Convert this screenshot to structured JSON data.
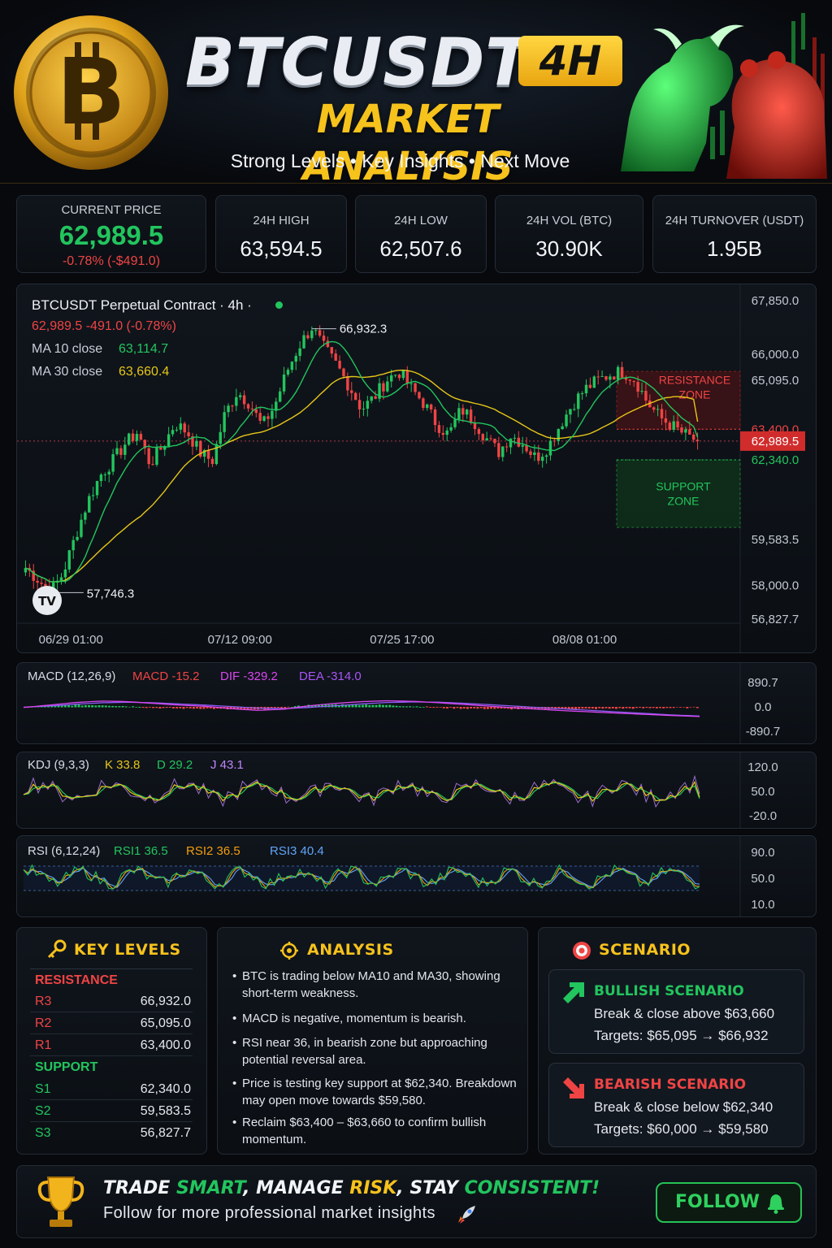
{
  "header": {
    "title": "BTCUSDT",
    "timeframe_badge": "4H",
    "subtitle": "MARKET ANALYSIS",
    "tagline": "Strong Levels  •  Key Insights  •  Next Move",
    "coin_symbol": "B"
  },
  "stats": [
    {
      "label": "CURRENT PRICE",
      "value": "62,989.5",
      "change": "-0.78% (-$491.0)"
    },
    {
      "label": "24H HIGH",
      "value": "63,594.5"
    },
    {
      "label": "24H LOW",
      "value": "62,507.6"
    },
    {
      "label": "24H VOL (BTC)",
      "value": "30.90K"
    },
    {
      "label": "24H TURNOVER (USDT)",
      "value": "1.95B"
    }
  ],
  "price_chart": {
    "symbol_line": "BTCUSDT Perpetual Contract · 4h ·",
    "price_line": "62,989.5  -491.0 (-0.78%)",
    "ma10_label": "MA 10 close",
    "ma10_value": "63,114.7",
    "ma30_label": "MA 30 close",
    "ma30_value": "63,660.4",
    "high_marker": "66,932.3",
    "low_marker": "57,746.3",
    "logo": "TV",
    "resistance_zone": "RESISTANCE ZONE",
    "support_zone": "SUPPORT ZONE",
    "current_price_tag": "62,989.5"
  },
  "indicators": {
    "macd": {
      "name": "MACD (12,26,9)",
      "macd": "MACD -15.2",
      "dif": "DIF -329.2",
      "dea": "DEA -314.0",
      "axis": [
        "890.7",
        "0.0",
        "-890.7"
      ]
    },
    "kdj": {
      "name": "KDJ (9,3,3)",
      "k": "K 33.8",
      "d": "D 29.2",
      "j": "J 43.1",
      "axis": [
        "120.0",
        "50.0",
        "-20.0"
      ]
    },
    "rsi": {
      "name": "RSI (6,12,24)",
      "rsi1": "RSI1 36.5",
      "rsi2": "RSI2 36.5",
      "rsi3": "RSI3 40.4",
      "axis": [
        "90.0",
        "50.0",
        "10.0"
      ]
    }
  },
  "key_levels": {
    "title": "KEY LEVELS",
    "resistance_label": "RESISTANCE",
    "support_label": "SUPPORT",
    "resistance": [
      {
        "name": "R3",
        "value": "66,932.0"
      },
      {
        "name": "R2",
        "value": "65,095.0"
      },
      {
        "name": "R1",
        "value": "63,400.0"
      }
    ],
    "support": [
      {
        "name": "S1",
        "value": "62,340.0"
      },
      {
        "name": "S2",
        "value": "59,583.5"
      },
      {
        "name": "S3",
        "value": "56,827.7"
      }
    ]
  },
  "analysis": {
    "title": "ANALYSIS",
    "items": [
      "BTC is trading below MA10 and MA30, showing short-term weakness.",
      "MACD is negative, momentum is bearish.",
      "RSI near 36, in bearish zone but approaching potential reversal area.",
      "Price is testing key support at $62,340. Breakdown may open move towards $59,580.",
      "Reclaim $63,400 – $63,660 to confirm bullish momentum."
    ]
  },
  "scenario": {
    "title": "SCENARIO",
    "bullish": {
      "title": "BULLISH SCENARIO",
      "line1": "Break & close above $63,660",
      "line2": "Targets: $65,095 → $66,932"
    },
    "bearish": {
      "title": "BEARISH SCENARIO",
      "line1": "Break & close below $62,340",
      "line2": "Targets: $60,000 → $59,580"
    }
  },
  "footer": {
    "slogan_parts": [
      "TRADE ",
      "SMART",
      ", MANAGE ",
      "RISK",
      ", STAY ",
      "CONSISTENT!"
    ],
    "subline": "Follow for more professional market insights",
    "follow_label": "FOLLOW"
  },
  "colors": {
    "up": "#22c55e",
    "down": "#ef4444",
    "ma10": "#22c55e",
    "ma30": "#e6c619",
    "gold": "#f6c21c",
    "dif": "#d946ef",
    "dea": "#3b82f6",
    "k": "#e6c619",
    "d": "#22c55e",
    "j": "#c084fc"
  },
  "chart_data": [
    {
      "type": "candlestick",
      "title": "BTCUSDT Perpetual Contract · 4h",
      "x_tick_labels": [
        "06/29 01:00",
        "07/12 09:00",
        "07/25 17:00",
        "08/08 01:00"
      ],
      "y_tick_labels": [
        "67,850.0",
        "66,000.0",
        "65,095.0",
        "63,400.0",
        "62,989.5",
        "62,340.0",
        "59,583.5",
        "58,000.0",
        "56,827.7"
      ],
      "ylim": [
        56827.7,
        67850
      ],
      "close_path": [
        58600,
        58200,
        57746,
        58400,
        59700,
        60900,
        61800,
        62300,
        62900,
        63300,
        62200,
        62800,
        63600,
        63300,
        62600,
        62300,
        63900,
        64700,
        64300,
        63500,
        64200,
        65400,
        66300,
        66932,
        66200,
        65600,
        64900,
        64100,
        64500,
        65100,
        65400,
        64800,
        64300,
        63600,
        63200,
        64100,
        63700,
        63100,
        62600,
        63200,
        62900,
        62400,
        62800,
        63600,
        64300,
        64800,
        65100,
        65300,
        65400,
        65100,
        64300,
        63800,
        63500,
        63200,
        62989.5
      ],
      "ma10_last": 63114.7,
      "ma30_last": 63660.4,
      "high": 66932.3,
      "low": 57746.3,
      "last": 62989.5,
      "resistance_zone": [
        63400,
        65400
      ],
      "support_zone": [
        60000,
        62340
      ]
    },
    {
      "type": "line",
      "title": "MACD (12,26,9)",
      "ylim": [
        -890.7,
        890.7
      ],
      "series": [
        {
          "name": "DIF",
          "values": [
            -20,
            60,
            150,
            200,
            180,
            120,
            60,
            20,
            -60,
            -120,
            -80,
            40,
            120,
            180,
            210,
            190,
            140,
            80,
            20,
            -40,
            -90,
            -140,
            -180,
            -220,
            -260,
            -300,
            -329.2
          ]
        },
        {
          "name": "DEA",
          "values": [
            -10,
            30,
            90,
            140,
            160,
            140,
            100,
            60,
            10,
            -40,
            -60,
            -20,
            40,
            100,
            150,
            170,
            160,
            120,
            70,
            20,
            -30,
            -80,
            -130,
            -180,
            -230,
            -280,
            -314
          ]
        },
        {
          "name": "MACD",
          "values": [
            -10,
            30,
            60,
            60,
            20,
            -20,
            -40,
            -40,
            -70,
            -80,
            -20,
            60,
            80,
            80,
            60,
            20,
            -20,
            -40,
            -50,
            -60,
            -60,
            -60,
            -50,
            -40,
            -30,
            -20,
            -15.2
          ]
        }
      ]
    },
    {
      "type": "line",
      "title": "KDJ (9,3,3)",
      "ylim": [
        -20,
        120
      ],
      "series": [
        {
          "name": "K",
          "last": 33.8
        },
        {
          "name": "D",
          "last": 29.2
        },
        {
          "name": "J",
          "last": 43.1
        }
      ]
    },
    {
      "type": "line",
      "title": "RSI (6,12,24)",
      "ylim": [
        10,
        90
      ],
      "series": [
        {
          "name": "RSI1",
          "last": 36.5
        },
        {
          "name": "RSI2",
          "last": 36.5
        },
        {
          "name": "RSI3",
          "last": 40.4
        }
      ]
    }
  ]
}
